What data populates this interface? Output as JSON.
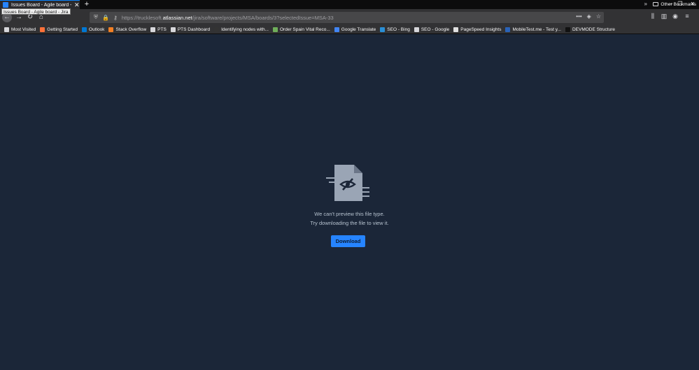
{
  "tab": {
    "title": "Issues Board - Agile board - Jira",
    "tooltip": "Issues Board - Agile board - Jira",
    "close": "✕",
    "new": "+"
  },
  "window_controls": {
    "minimize": "–",
    "restore": "❐",
    "close": "✕"
  },
  "nav": {
    "url_prefix": "https://trucklesoft.",
    "url_domain": "atlassian.net",
    "url_path": "/jira/software/projects/MSA/boards/3?selectedIssue=MSA-33"
  },
  "bookmarks": [
    {
      "label": "Most Visited",
      "icon": "gear-icon",
      "color": "#d7d7db"
    },
    {
      "label": "Getting Started",
      "icon": "firefox-icon",
      "color": "#ff7139"
    },
    {
      "label": "Outlook",
      "icon": "outlook-icon",
      "color": "#0078d4"
    },
    {
      "label": "Stack Overflow",
      "icon": "stackoverflow-icon",
      "color": "#f48024"
    },
    {
      "label": "PTS",
      "icon": "page-icon",
      "color": "#d7d7db"
    },
    {
      "label": "PTS Dashboard",
      "icon": "page-icon",
      "color": "#d7d7db"
    },
    {
      "label": "Identifying nodes with...",
      "icon": "github-icon",
      "color": "#333333"
    },
    {
      "label": "Order Spain Vital Reco...",
      "icon": "tree-icon",
      "color": "#6fae5a"
    },
    {
      "label": "Google Translate",
      "icon": "translate-icon",
      "color": "#4285f4"
    },
    {
      "label": "SEO - Bing",
      "icon": "bing-icon",
      "color": "#2a8fd6"
    },
    {
      "label": "SEO - Google",
      "icon": "page-icon",
      "color": "#d7d7db"
    },
    {
      "label": "PageSpeed Insights",
      "icon": "pagespeed-icon",
      "color": "#e0e0e0"
    },
    {
      "label": "MobileTest.me - Test y...",
      "icon": "mobiletest-icon",
      "color": "#2a63b8"
    },
    {
      "label": "DEVMODE Structure",
      "icon": "devmode-icon",
      "color": "#111111"
    }
  ],
  "bookmarks_other": "Other Bookmarks",
  "viewer": {
    "message_line1": "We can't preview this file type.",
    "message_line2": "Try downloading the file to view it.",
    "download_label": "Download"
  }
}
